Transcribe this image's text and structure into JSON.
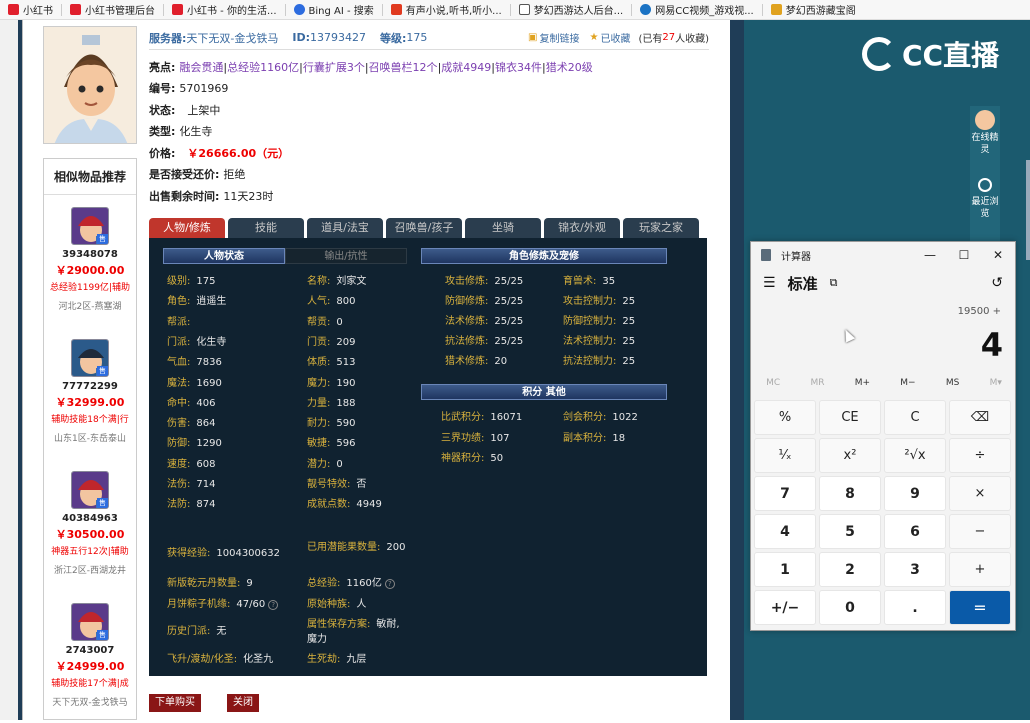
{
  "bookmarks": [
    {
      "label": "小红书",
      "color": "#e01f2c"
    },
    {
      "label": "小红书管理后台",
      "color": "#e01f2c"
    },
    {
      "label": "小红书 - 你的生活...",
      "color": "#e01f2c"
    },
    {
      "label": "Bing AI - 搜索",
      "color": "#2d6cdf"
    },
    {
      "label": "有声小说,听书,听小...",
      "color": "#e03a1f"
    },
    {
      "label": "梦幻西游达人后台...",
      "color": "#555555"
    },
    {
      "label": "网易CC视频_游戏视...",
      "color": "#1b73c4"
    },
    {
      "label": "梦幻西游藏宝阁",
      "color": "#e0a21f"
    }
  ],
  "header": {
    "server_label": "服务器:",
    "server_value": "天下无双-金戈铁马",
    "id_label": "ID:",
    "id_value": "13793427",
    "level_label": "等级:",
    "level_value": "175",
    "copy_link": "复制链接",
    "collected": "已收藏",
    "count_prefix": "(已有",
    "count_value": "27",
    "count_suffix": "人收藏)"
  },
  "info": {
    "highlight_label": "亮点:",
    "highlights": [
      "融会贯通",
      "总经验1160亿",
      "行囊扩展3个",
      "召唤兽栏12个",
      "成就4949",
      "锦衣34件",
      "猎术20级"
    ],
    "serial_label": "编号:",
    "serial_value": "5701969",
    "status_label": "状态:",
    "status_value": "上架中",
    "type_label": "类型:",
    "type_value": "化生寺",
    "price_label": "价格:",
    "price_value": "￥26666.00（元）",
    "bargain_label": "是否接受还价:",
    "bargain_value": "拒绝",
    "remain_label": "出售剩余时间:",
    "remain_value": "11天23时"
  },
  "tabs": [
    "人物/修炼",
    "技能",
    "道具/法宝",
    "召唤兽/孩子",
    "坐骑",
    "锦衣/外观",
    "玩家之家"
  ],
  "panel": {
    "head_status": "人物状态",
    "head_output": "输出/抗性",
    "head_cultivation": "角色修炼及宠修",
    "head_points": "积分 其他",
    "col1": [
      {
        "k": "级别:",
        "v": "175"
      },
      {
        "k": "角色:",
        "v": "逍遥生"
      },
      {
        "k": "帮派:",
        "v": ""
      },
      {
        "k": "门派:",
        "v": "化生寺"
      },
      {
        "k": "气血:",
        "v": "7836"
      },
      {
        "k": "魔法:",
        "v": "1690"
      },
      {
        "k": "命中:",
        "v": "406"
      },
      {
        "k": "伤害:",
        "v": "864"
      },
      {
        "k": "防御:",
        "v": "1290"
      },
      {
        "k": "速度:",
        "v": "608"
      },
      {
        "k": "法伤:",
        "v": "714"
      },
      {
        "k": "法防:",
        "v": "874"
      }
    ],
    "col2": [
      {
        "k": "名称:",
        "v": "刘家文"
      },
      {
        "k": "人气:",
        "v": "800"
      },
      {
        "k": "帮贡:",
        "v": "0"
      },
      {
        "k": "门贡:",
        "v": "209"
      },
      {
        "k": "体质:",
        "v": "513"
      },
      {
        "k": "魔力:",
        "v": "190"
      },
      {
        "k": "力量:",
        "v": "188"
      },
      {
        "k": "耐力:",
        "v": "590"
      },
      {
        "k": "敏捷:",
        "v": "596"
      },
      {
        "k": "潜力:",
        "v": "0"
      },
      {
        "k": "靓号特效:",
        "v": "否"
      },
      {
        "k": "成就点数:",
        "v": "4949"
      }
    ],
    "exp_label": "获得经验:",
    "exp_value": "1004300632",
    "potion_label": "已用潜能果数量:",
    "potion_value": "200",
    "qiankun_label": "新版乾元丹数量:",
    "qiankun_value": "9",
    "total_exp_label": "总经验:",
    "total_exp_value": "1160亿",
    "moon_label": "月饼粽子机缘:",
    "moon_value": "47/60",
    "race_label": "原始种族:",
    "race_value": "人",
    "history_label": "历史门派:",
    "history_value": "无",
    "attr_label": "属性保存方案:",
    "attr_value": "敏耐,魔力",
    "fly_label": "飞升/渡劫/化圣:",
    "fly_value": "化圣九",
    "life_label": "生死劫:",
    "life_value": "九层",
    "cultivation": [
      {
        "k": "攻击修炼:",
        "v": "25/25",
        "k2": "育兽术:",
        "v2": "35"
      },
      {
        "k": "防御修炼:",
        "v": "25/25",
        "k2": "攻击控制力:",
        "v2": "25"
      },
      {
        "k": "法术修炼:",
        "v": "25/25",
        "k2": "防御控制力:",
        "v2": "25"
      },
      {
        "k": "抗法修炼:",
        "v": "25/25",
        "k2": "法术控制力:",
        "v2": "25"
      },
      {
        "k": "猎术修炼:",
        "v": "20",
        "k2": "抗法控制力:",
        "v2": "25"
      }
    ],
    "points": [
      {
        "k": "比武积分:",
        "v": "16071",
        "k2": "剑会积分:",
        "v2": "1022"
      },
      {
        "k": "三界功绩:",
        "v": "107",
        "k2": "副本积分:",
        "v2": "18"
      },
      {
        "k": "神器积分:",
        "v": "50",
        "k2": "",
        "v2": ""
      }
    ]
  },
  "buttons": {
    "buy": "下单购买",
    "close": "关闭"
  },
  "recommend": {
    "title": "相似物品推荐",
    "items": [
      {
        "id": "39348078",
        "price": "￥29000.00",
        "desc": "总经验1199亿|辅助",
        "server": "河北2区-燕塞湖"
      },
      {
        "id": "77772299",
        "price": "￥32999.00",
        "desc": "辅助技能18个满|行",
        "server": "山东1区-东岳泰山"
      },
      {
        "id": "40384963",
        "price": "￥30500.00",
        "desc": "神器五行12次|辅助",
        "server": "浙江2区-西湖龙井"
      },
      {
        "id": "2743007",
        "price": "￥24999.00",
        "desc": "辅助技能17个满|成",
        "server": "天下无双-金戈铁马"
      }
    ],
    "badge": "售"
  },
  "cc": {
    "logo": "CC直播",
    "online_label": "在线精灵",
    "recent_label": "最近浏览"
  },
  "calculator": {
    "title": "计算器",
    "mode": "标准",
    "expression": "19500 +",
    "display": "4",
    "memory": [
      "MC",
      "MR",
      "M+",
      "M−",
      "MS",
      "M▾"
    ],
    "keys": [
      "%",
      "CE",
      "C",
      "⌫",
      "¹⁄ₓ",
      "x²",
      "²√x",
      "÷",
      "7",
      "8",
      "9",
      "×",
      "4",
      "5",
      "6",
      "−",
      "1",
      "2",
      "3",
      "+",
      "+/−",
      "0",
      ".",
      "="
    ]
  }
}
